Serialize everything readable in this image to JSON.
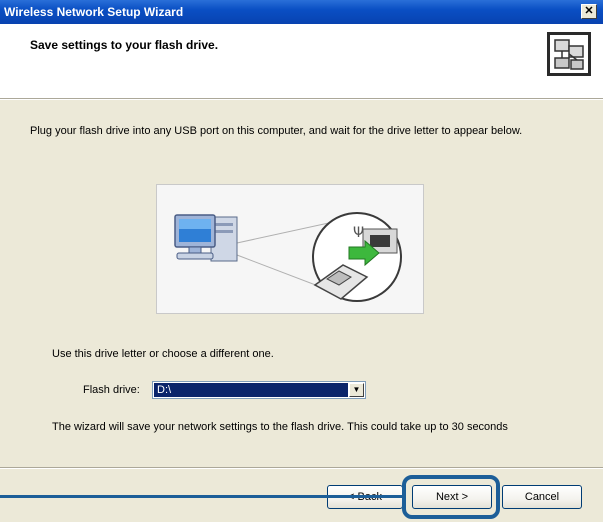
{
  "window": {
    "title": "Wireless Network Setup Wizard",
    "close_glyph": "✕"
  },
  "header": {
    "title": "Save settings to your flash drive.",
    "icon": "network-setup-icon"
  },
  "content": {
    "intro": "Plug your flash drive into any USB port on this computer, and wait for the drive letter to appear below.",
    "illustration_icons": [
      "computer-icon",
      "usb-flash-drive-icon"
    ],
    "use_drive_text": "Use this drive letter or choose a different one.",
    "flash_drive": {
      "label": "Flash drive:",
      "value": "D:\\"
    },
    "wizard_text": "The wizard will save your network settings to the flash drive. This could take up to 30 seconds"
  },
  "footer": {
    "back_label": "< Back",
    "next_label": "Next >",
    "cancel_label": "Cancel"
  },
  "colors": {
    "titlebar": "#0a4fc4",
    "dialog": "#ece9d8",
    "selection": "#0a246a",
    "highlight": "#1c5e98",
    "usb_arrow": "#3db83d"
  }
}
